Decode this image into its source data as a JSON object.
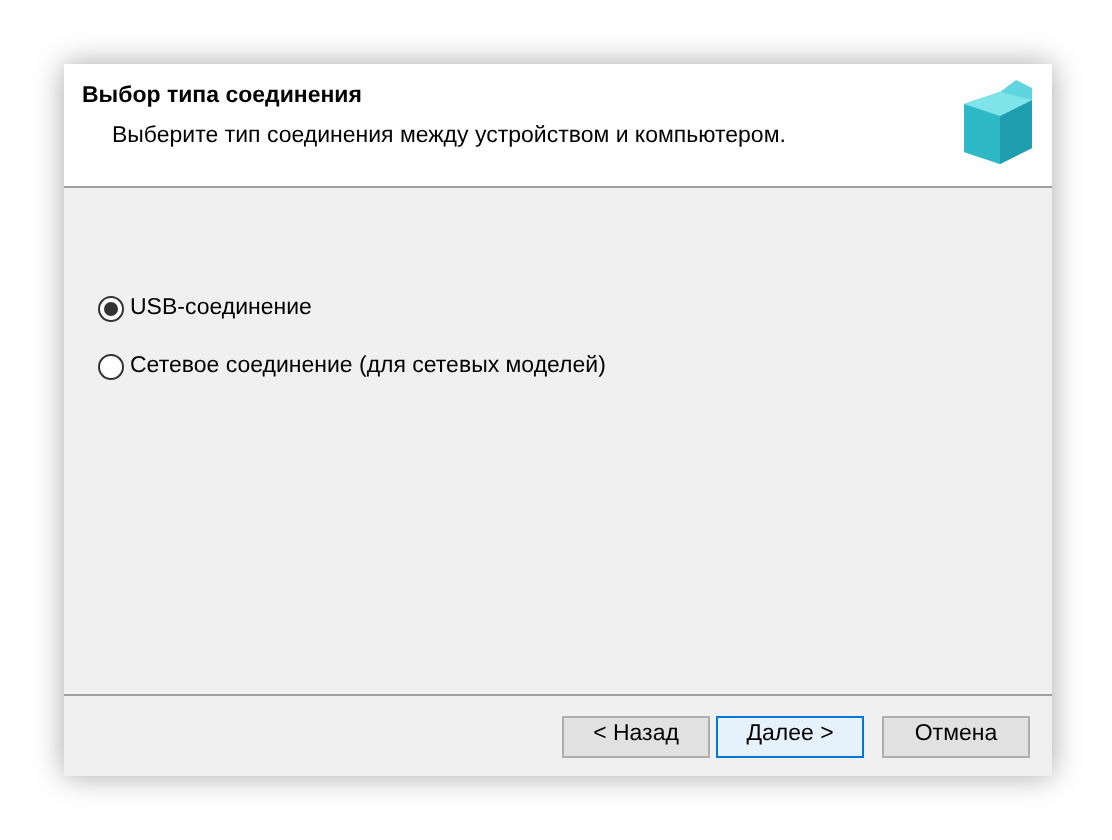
{
  "header": {
    "title": "Выбор типа соединения",
    "subtitle": "Выберите тип соединения между устройством и компьютером."
  },
  "options": [
    {
      "label": "USB-соединение",
      "selected": true
    },
    {
      "label": "Сетевое соединение (для сетевых моделей)",
      "selected": false
    }
  ],
  "buttons": [
    {
      "label": "< Назад",
      "default": false
    },
    {
      "label": "Далее >",
      "default": true
    },
    {
      "label": "Отмена",
      "default": false
    }
  ]
}
